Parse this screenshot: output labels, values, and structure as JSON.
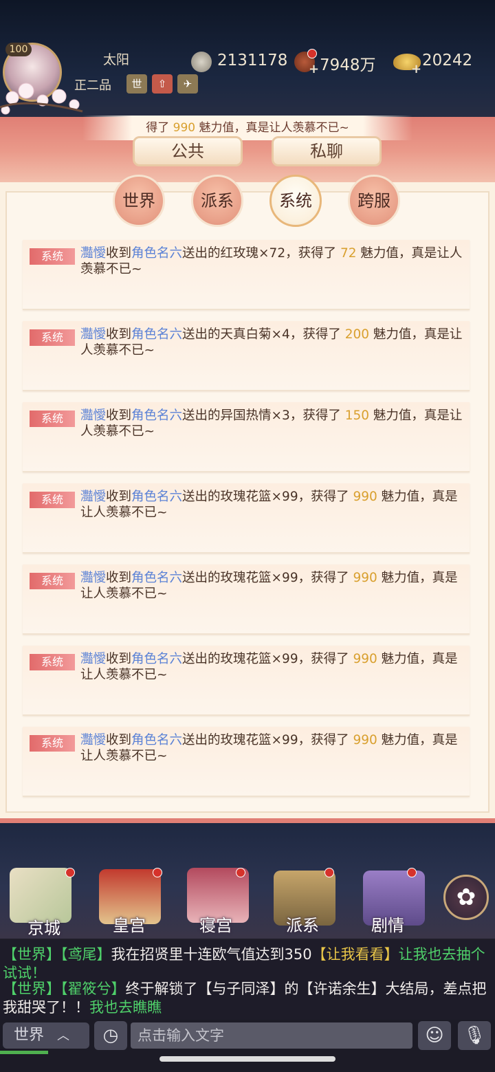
{
  "player": {
    "level": "100",
    "name": "太阳",
    "rank": "正二品",
    "tag_buttons": [
      "世",
      "⇧",
      "✈"
    ]
  },
  "currencies": [
    {
      "name": "silver-coin-icon",
      "value": "2131178"
    },
    {
      "name": "copper-coin-icon",
      "value": "7948万"
    },
    {
      "name": "gold-ingot-icon",
      "value": "20242"
    }
  ],
  "ticker": {
    "prefix": "得了 ",
    "value": "990",
    "suffix": " 魅力值，真是让人羡慕不已~"
  },
  "top_tabs": [
    "公共",
    "私聊"
  ],
  "channel_tabs": [
    {
      "label": "世界",
      "active": false
    },
    {
      "label": "派系",
      "active": false
    },
    {
      "label": "系统",
      "active": true
    },
    {
      "label": "跨服",
      "active": false
    }
  ],
  "messages": [
    {
      "tag": "系统",
      "sender": "灩懓",
      "verb": "收到",
      "from": "角色名六",
      "gift": "送出的红玫瑰×72，获得了 ",
      "value": "72",
      "tail": " 魅力值，真是让人羡慕不已~"
    },
    {
      "tag": "系统",
      "sender": "灩懓",
      "verb": "收到",
      "from": "角色名六",
      "gift": "送出的天真白菊×4，获得了 ",
      "value": "200",
      "tail": " 魅力值，真是让人羡慕不已~"
    },
    {
      "tag": "系统",
      "sender": "灩懓",
      "verb": "收到",
      "from": "角色名六",
      "gift": "送出的异国热情×3，获得了 ",
      "value": "150",
      "tail": " 魅力值，真是让人羡慕不已~"
    },
    {
      "tag": "系统",
      "sender": "灩懓",
      "verb": "收到",
      "from": "角色名六",
      "gift": "送出的玫瑰花篮×99，获得了 ",
      "value": "990",
      "tail": " 魅力值，真是让人羡慕不已~"
    },
    {
      "tag": "系统",
      "sender": "灩懓",
      "verb": "收到",
      "from": "角色名六",
      "gift": "送出的玫瑰花篮×99，获得了 ",
      "value": "990",
      "tail": " 魅力值，真是让人羡慕不已~"
    },
    {
      "tag": "系统",
      "sender": "灩懓",
      "verb": "收到",
      "from": "角色名六",
      "gift": "送出的玫瑰花篮×99，获得了 ",
      "value": "990",
      "tail": " 魅力值，真是让人羡慕不已~"
    },
    {
      "tag": "系统",
      "sender": "灩懓",
      "verb": "收到",
      "from": "角色名六",
      "gift": "送出的玫瑰花篮×99，获得了 ",
      "value": "990",
      "tail": " 魅力值，真是让人羡慕不已~"
    }
  ],
  "nav": [
    {
      "label": "京城",
      "icon": "map-icon"
    },
    {
      "label": "皇宫",
      "icon": "palace-icon"
    },
    {
      "label": "寝宫",
      "icon": "bedchamber-icon"
    },
    {
      "label": "派系",
      "icon": "faction-icon"
    },
    {
      "label": "剧情",
      "icon": "story-book-icon"
    }
  ],
  "world_chat": [
    {
      "channel": "【世界】",
      "user": "【鸢尾】",
      "text": "我在招贤里十连欧气值达到350",
      "link": "【让我看看】",
      "link2": "让我也去抽个试试！"
    },
    {
      "channel": "【世界】",
      "user": "【翟筱兮】",
      "text": "终于解锁了【与子同泽】的【许诺余生】大结局，差点把我甜哭了！！",
      "link": "我也去瞧瞧"
    }
  ],
  "input": {
    "channel": "世界",
    "placeholder": "点击输入文字"
  },
  "colors": {
    "accent_red": "#e07f75",
    "value_gold": "#d9a02f",
    "name_blue": "#5b82d6",
    "chat_green": "#4fd06a"
  }
}
